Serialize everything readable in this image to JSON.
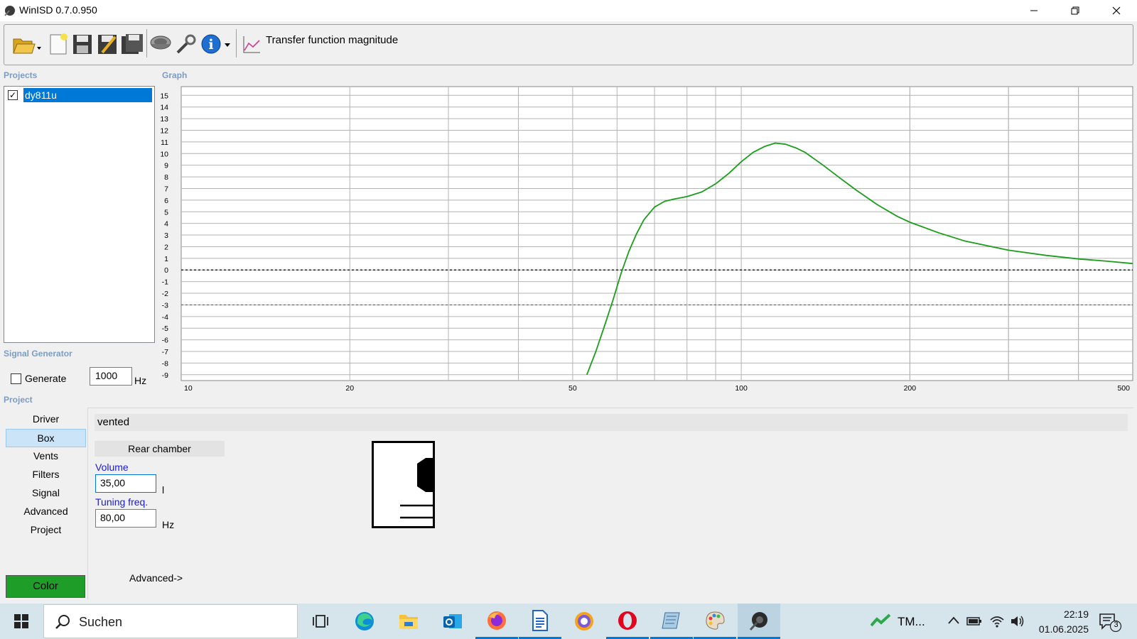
{
  "window": {
    "title": "WinISD 0.7.0.950"
  },
  "toolbar": {
    "graph_type_label": "Transfer function magnitude",
    "buttons": [
      "open-folder-icon",
      "new-project-icon",
      "save-icon",
      "save-as-icon",
      "save-all-icon",
      "driver-editor-icon",
      "tools-icon",
      "info-icon"
    ]
  },
  "sections": {
    "projects": "Projects",
    "graph": "Graph",
    "signal_generator": "Signal Generator",
    "project": "Project"
  },
  "projects": {
    "items": [
      {
        "name": "dy811u",
        "checked": true,
        "selected": true
      }
    ]
  },
  "signal_generator": {
    "generate_label": "Generate",
    "generate_checked": false,
    "frequency": "1000",
    "unit": "Hz"
  },
  "project_nav": {
    "items": [
      {
        "label": "Driver",
        "selected": false
      },
      {
        "label": "Box",
        "selected": true
      },
      {
        "label": "Vents",
        "selected": false
      },
      {
        "label": "Filters",
        "selected": false
      },
      {
        "label": "Signal",
        "selected": false
      },
      {
        "label": "Advanced",
        "selected": false
      },
      {
        "label": "Project",
        "selected": false
      }
    ],
    "color_button": "Color",
    "color_value": "#1e9e28"
  },
  "box": {
    "type": "vented",
    "chamber_label": "Rear chamber",
    "volume_label": "Volume",
    "volume_value": "35,00",
    "volume_unit": "l",
    "tuning_label": "Tuning freq.",
    "tuning_value": "80,00",
    "tuning_unit": "Hz",
    "advanced_link": "Advanced->"
  },
  "chart_data": {
    "type": "line",
    "title": "",
    "xlabel": "",
    "ylabel": "",
    "x_scale": "log",
    "xlim": [
      10,
      500
    ],
    "ylim": [
      -9,
      15
    ],
    "x_ticks": [
      "10",
      "20",
      "50",
      "100",
      "200",
      "500"
    ],
    "y_ticks": [
      "15",
      "14",
      "13",
      "12",
      "11",
      "10",
      "9",
      "8",
      "7",
      "6",
      "5",
      "4",
      "3",
      "2",
      "1",
      "0",
      "-1",
      "-2",
      "-3",
      "-4",
      "-5",
      "-6",
      "-7",
      "-8",
      "-9"
    ],
    "reference_lines": [
      0,
      -3
    ],
    "grid": true,
    "series": [
      {
        "color": "#1a9e1a",
        "x": [
          53,
          55,
          57,
          59,
          61,
          63,
          65,
          67,
          70,
          73,
          76,
          80,
          85,
          90,
          95,
          100,
          105,
          110,
          115,
          120,
          125,
          130,
          140,
          150,
          160,
          175,
          190,
          200,
          225,
          250,
          300,
          350,
          400,
          450,
          500
        ],
        "y": [
          -9,
          -7,
          -4.8,
          -2.6,
          -0.3,
          1.6,
          3.1,
          4.3,
          5.4,
          5.9,
          6.1,
          6.3,
          6.7,
          7.4,
          8.3,
          9.3,
          10.1,
          10.6,
          10.9,
          10.8,
          10.5,
          10.1,
          9.0,
          7.9,
          6.9,
          5.6,
          4.6,
          4.1,
          3.2,
          2.5,
          1.7,
          1.25,
          0.95,
          0.75,
          0.55
        ]
      }
    ]
  },
  "taskbar": {
    "search_placeholder": "Suchen",
    "tm_label": "TM...",
    "time": "22:19",
    "date": "01.06.2025",
    "notifications": "3"
  }
}
